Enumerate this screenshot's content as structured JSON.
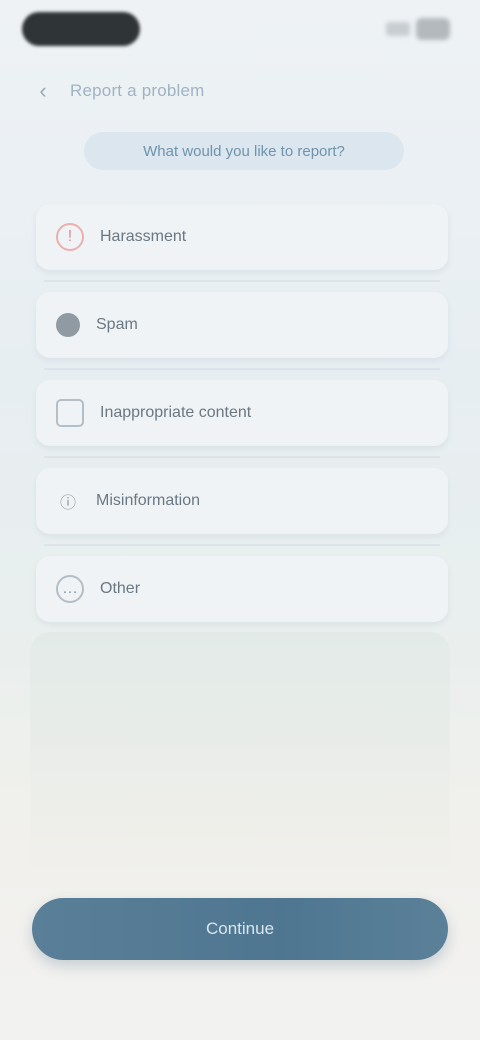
{
  "header": {
    "title": "Report a problem",
    "back_icon": "back-arrow-icon"
  },
  "subtitle": "What would you like to report?",
  "options": [
    {
      "label": "Harassment",
      "icon": "warning-icon",
      "icon_color": "#e58b8b"
    },
    {
      "label": "Spam",
      "icon": "person-icon",
      "icon_color": "#8a96a0"
    },
    {
      "label": "Inappropriate content",
      "icon": "image-icon",
      "icon_color": "#8a96a0"
    },
    {
      "label": "Misinformation",
      "icon": "info-icon",
      "icon_color": "#8a96a0"
    },
    {
      "label": "Other",
      "icon": "more-icon",
      "icon_color": "#8a96a0"
    }
  ],
  "action_button": {
    "label": "Continue",
    "color": "#567b95"
  }
}
